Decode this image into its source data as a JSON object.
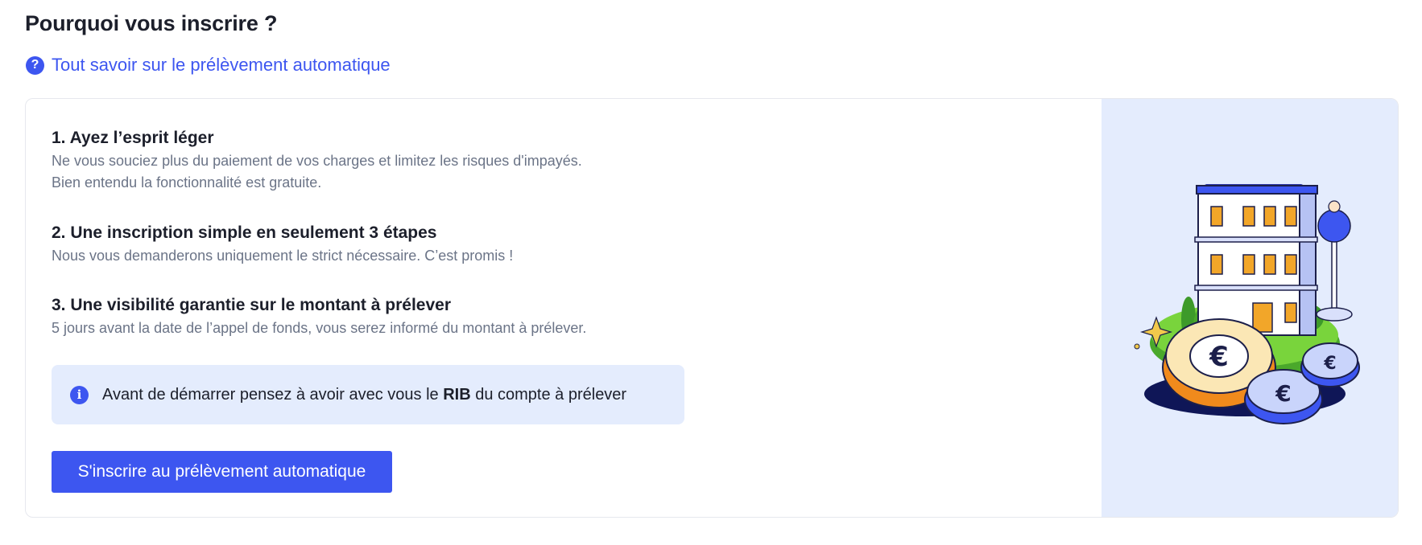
{
  "page": {
    "title": "Pourquoi vous inscrire ?",
    "help_link": "Tout savoir sur le prélèvement automatique"
  },
  "icons": {
    "help": "question-circle-icon",
    "info": "info-circle-icon"
  },
  "reasons": [
    {
      "title": "1. Ayez l’esprit léger",
      "lines": [
        "Ne vous souciez plus du paiement de vos charges et limitez les risques d'impayés.",
        "Bien entendu la fonctionnalité est gratuite."
      ]
    },
    {
      "title": "2. Une inscription simple en seulement 3 étapes",
      "lines": [
        "Nous vous demanderons uniquement le strict nécessaire. C’est promis !"
      ]
    },
    {
      "title": "3. Une visibilité garantie sur le montant à prélever",
      "lines": [
        "5 jours avant la date de l’appel de fonds, vous serez informé du montant à prélever."
      ]
    }
  ],
  "notice": {
    "before": "Avant de démarrer pensez à avoir avec vous le ",
    "bold": "RIB",
    "after": " du compte à prélever"
  },
  "cta": {
    "label": "S'inscrire au prélèvement automatique"
  },
  "colors": {
    "accent": "#3d56f0",
    "panel_bg": "#e4ecfd",
    "muted_text": "#6b7487"
  }
}
